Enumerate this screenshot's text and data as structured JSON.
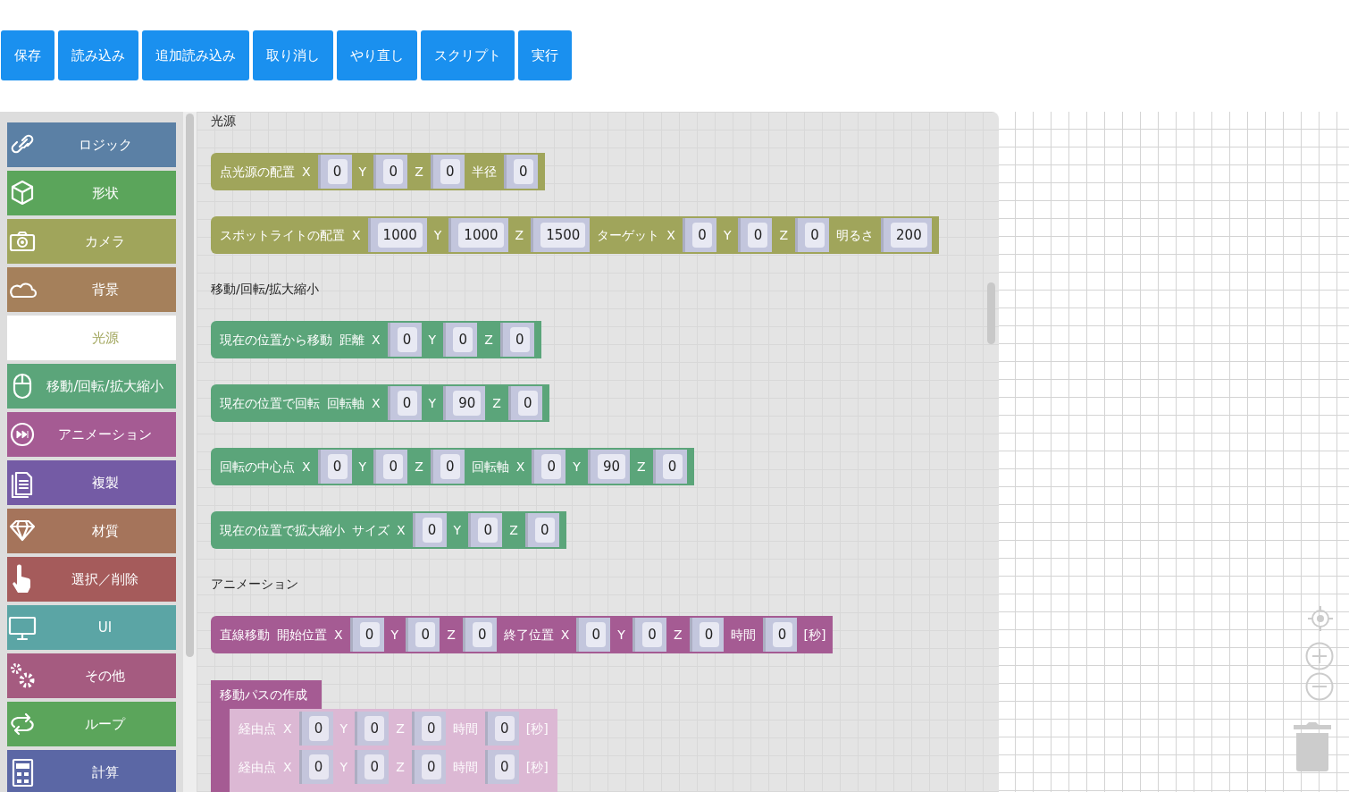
{
  "toolbar": {
    "buttons": [
      "保存",
      "読み込み",
      "追加読み込み",
      "取り消し",
      "やり直し",
      "スクリプト",
      "実行"
    ]
  },
  "categories": [
    {
      "label": "ロジック",
      "color": "#5b80a5",
      "selected": false
    },
    {
      "label": "形状",
      "color": "#5ba55b",
      "selected": false
    },
    {
      "label": "カメラ",
      "color": "#a0a55b",
      "selected": false
    },
    {
      "label": "背景",
      "color": "#a5805b",
      "selected": false
    },
    {
      "label": "光源",
      "color": "#a0a55b",
      "selected": true
    },
    {
      "label": "移動/回転/拡大縮小",
      "color": "#5ba57a",
      "selected": false
    },
    {
      "label": "アニメーション",
      "color": "#a55b93",
      "selected": false
    },
    {
      "label": "複製",
      "color": "#745ba5",
      "selected": false
    },
    {
      "label": "材質",
      "color": "#a5745b",
      "selected": false
    },
    {
      "label": "選択／削除",
      "color": "#a55b5b",
      "selected": false
    },
    {
      "label": "UI",
      "color": "#5ba5a5",
      "selected": false
    },
    {
      "label": "その他",
      "color": "#a55b80",
      "selected": false
    },
    {
      "label": "ループ",
      "color": "#5ba55b",
      "selected": false
    },
    {
      "label": "計算",
      "color": "#5b67a5",
      "selected": false
    }
  ],
  "flyout": {
    "sections": [
      {
        "heading": "光源",
        "blocks": [
          {
            "kind": "statement",
            "color": "#a0a55b",
            "fields": [
              {
                "kind": "label",
                "text": "点光源の配置"
              },
              {
                "kind": "label",
                "text": "X"
              },
              {
                "kind": "input",
                "value": "0"
              },
              {
                "kind": "label",
                "text": "Y"
              },
              {
                "kind": "input",
                "value": "0"
              },
              {
                "kind": "label",
                "text": "Z"
              },
              {
                "kind": "input",
                "value": "0"
              },
              {
                "kind": "label",
                "text": "半径"
              },
              {
                "kind": "input",
                "value": "0"
              }
            ]
          },
          {
            "kind": "statement",
            "color": "#a0a55b",
            "fields": [
              {
                "kind": "label",
                "text": "スポットライトの配置"
              },
              {
                "kind": "label",
                "text": "X"
              },
              {
                "kind": "input",
                "value": "1000"
              },
              {
                "kind": "label",
                "text": "Y"
              },
              {
                "kind": "input",
                "value": "1000"
              },
              {
                "kind": "label",
                "text": "Z"
              },
              {
                "kind": "input",
                "value": "1500"
              },
              {
                "kind": "label",
                "text": "ターゲット"
              },
              {
                "kind": "label",
                "text": "X"
              },
              {
                "kind": "input",
                "value": "0"
              },
              {
                "kind": "label",
                "text": "Y"
              },
              {
                "kind": "input",
                "value": "0"
              },
              {
                "kind": "label",
                "text": "Z"
              },
              {
                "kind": "input",
                "value": "0"
              },
              {
                "kind": "label",
                "text": "明るさ"
              },
              {
                "kind": "input",
                "value": "200"
              }
            ]
          }
        ]
      },
      {
        "heading": "移動/回転/拡大縮小",
        "blocks": [
          {
            "kind": "statement",
            "color": "#5ba57a",
            "fields": [
              {
                "kind": "label",
                "text": "現在の位置から移動"
              },
              {
                "kind": "label",
                "text": "距離"
              },
              {
                "kind": "label",
                "text": "X"
              },
              {
                "kind": "input",
                "value": "0"
              },
              {
                "kind": "label",
                "text": "Y"
              },
              {
                "kind": "input",
                "value": "0"
              },
              {
                "kind": "label",
                "text": "Z"
              },
              {
                "kind": "input",
                "value": "0"
              }
            ]
          },
          {
            "kind": "statement",
            "color": "#5ba57a",
            "fields": [
              {
                "kind": "label",
                "text": "現在の位置で回転"
              },
              {
                "kind": "label",
                "text": "回転軸"
              },
              {
                "kind": "label",
                "text": "X"
              },
              {
                "kind": "input",
                "value": "0"
              },
              {
                "kind": "label",
                "text": "Y"
              },
              {
                "kind": "input",
                "value": "90"
              },
              {
                "kind": "label",
                "text": "Z"
              },
              {
                "kind": "input",
                "value": "0"
              }
            ]
          },
          {
            "kind": "statement",
            "color": "#5ba57a",
            "fields": [
              {
                "kind": "label",
                "text": "回転の中心点"
              },
              {
                "kind": "label",
                "text": "X"
              },
              {
                "kind": "input",
                "value": "0"
              },
              {
                "kind": "label",
                "text": "Y"
              },
              {
                "kind": "input",
                "value": "0"
              },
              {
                "kind": "label",
                "text": "Z"
              },
              {
                "kind": "input",
                "value": "0"
              },
              {
                "kind": "label",
                "text": "回転軸"
              },
              {
                "kind": "label",
                "text": "X"
              },
              {
                "kind": "input",
                "value": "0"
              },
              {
                "kind": "label",
                "text": "Y"
              },
              {
                "kind": "input",
                "value": "90"
              },
              {
                "kind": "label",
                "text": "Z"
              },
              {
                "kind": "input",
                "value": "0"
              }
            ]
          },
          {
            "kind": "statement",
            "color": "#5ba57a",
            "fields": [
              {
                "kind": "label",
                "text": "現在の位置で拡大縮小"
              },
              {
                "kind": "label",
                "text": "サイズ"
              },
              {
                "kind": "label",
                "text": "X"
              },
              {
                "kind": "input",
                "value": "0"
              },
              {
                "kind": "label",
                "text": "Y"
              },
              {
                "kind": "input",
                "value": "0"
              },
              {
                "kind": "label",
                "text": "Z"
              },
              {
                "kind": "input",
                "value": "0"
              }
            ]
          }
        ]
      },
      {
        "heading": "アニメーション",
        "blocks": [
          {
            "kind": "statement",
            "color": "#a55b93",
            "fields": [
              {
                "kind": "label",
                "text": "直線移動"
              },
              {
                "kind": "label",
                "text": "開始位置"
              },
              {
                "kind": "label",
                "text": "X"
              },
              {
                "kind": "input",
                "value": "0"
              },
              {
                "kind": "label",
                "text": "Y"
              },
              {
                "kind": "input",
                "value": "0"
              },
              {
                "kind": "label",
                "text": "Z"
              },
              {
                "kind": "input",
                "value": "0"
              },
              {
                "kind": "label",
                "text": "終了位置"
              },
              {
                "kind": "label",
                "text": "X"
              },
              {
                "kind": "input",
                "value": "0"
              },
              {
                "kind": "label",
                "text": "Y"
              },
              {
                "kind": "input",
                "value": "0"
              },
              {
                "kind": "label",
                "text": "Z"
              },
              {
                "kind": "input",
                "value": "0"
              },
              {
                "kind": "label",
                "text": "時間"
              },
              {
                "kind": "input",
                "value": "0"
              },
              {
                "kind": "label",
                "text": "[秒]"
              }
            ]
          },
          {
            "kind": "container",
            "color": "#a55b93",
            "title": "移動パスの作成",
            "rows": [
              {
                "fields": [
                  {
                    "kind": "label",
                    "text": "経由点"
                  },
                  {
                    "kind": "label",
                    "text": "X"
                  },
                  {
                    "kind": "input",
                    "value": "0"
                  },
                  {
                    "kind": "label",
                    "text": "Y"
                  },
                  {
                    "kind": "input",
                    "value": "0"
                  },
                  {
                    "kind": "label",
                    "text": "Z"
                  },
                  {
                    "kind": "input",
                    "value": "0"
                  },
                  {
                    "kind": "label",
                    "text": "時間"
                  },
                  {
                    "kind": "input",
                    "value": "0"
                  },
                  {
                    "kind": "label",
                    "text": "[秒]"
                  }
                ]
              },
              {
                "fields": [
                  {
                    "kind": "label",
                    "text": "経由点"
                  },
                  {
                    "kind": "label",
                    "text": "X"
                  },
                  {
                    "kind": "input",
                    "value": "0"
                  },
                  {
                    "kind": "label",
                    "text": "Y"
                  },
                  {
                    "kind": "input",
                    "value": "0"
                  },
                  {
                    "kind": "label",
                    "text": "Z"
                  },
                  {
                    "kind": "input",
                    "value": "0"
                  },
                  {
                    "kind": "label",
                    "text": "時間"
                  },
                  {
                    "kind": "input",
                    "value": "0"
                  },
                  {
                    "kind": "label",
                    "text": "[秒]"
                  }
                ]
              }
            ]
          }
        ]
      }
    ]
  }
}
